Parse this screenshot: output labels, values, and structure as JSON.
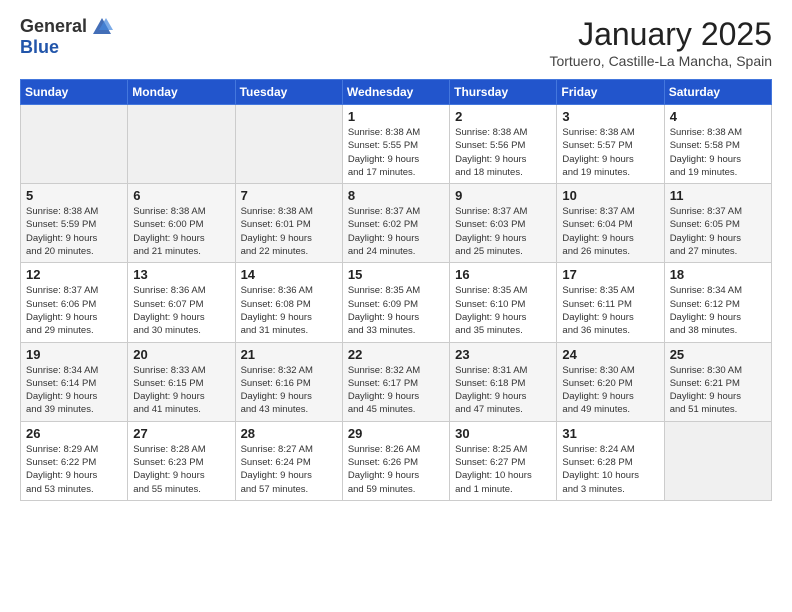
{
  "header": {
    "logo_general": "General",
    "logo_blue": "Blue",
    "month_title": "January 2025",
    "location": "Tortuero, Castille-La Mancha, Spain"
  },
  "weekdays": [
    "Sunday",
    "Monday",
    "Tuesday",
    "Wednesday",
    "Thursday",
    "Friday",
    "Saturday"
  ],
  "weeks": [
    [
      {
        "day": "",
        "info": ""
      },
      {
        "day": "",
        "info": ""
      },
      {
        "day": "",
        "info": ""
      },
      {
        "day": "1",
        "info": "Sunrise: 8:38 AM\nSunset: 5:55 PM\nDaylight: 9 hours\nand 17 minutes."
      },
      {
        "day": "2",
        "info": "Sunrise: 8:38 AM\nSunset: 5:56 PM\nDaylight: 9 hours\nand 18 minutes."
      },
      {
        "day": "3",
        "info": "Sunrise: 8:38 AM\nSunset: 5:57 PM\nDaylight: 9 hours\nand 19 minutes."
      },
      {
        "day": "4",
        "info": "Sunrise: 8:38 AM\nSunset: 5:58 PM\nDaylight: 9 hours\nand 19 minutes."
      }
    ],
    [
      {
        "day": "5",
        "info": "Sunrise: 8:38 AM\nSunset: 5:59 PM\nDaylight: 9 hours\nand 20 minutes."
      },
      {
        "day": "6",
        "info": "Sunrise: 8:38 AM\nSunset: 6:00 PM\nDaylight: 9 hours\nand 21 minutes."
      },
      {
        "day": "7",
        "info": "Sunrise: 8:38 AM\nSunset: 6:01 PM\nDaylight: 9 hours\nand 22 minutes."
      },
      {
        "day": "8",
        "info": "Sunrise: 8:37 AM\nSunset: 6:02 PM\nDaylight: 9 hours\nand 24 minutes."
      },
      {
        "day": "9",
        "info": "Sunrise: 8:37 AM\nSunset: 6:03 PM\nDaylight: 9 hours\nand 25 minutes."
      },
      {
        "day": "10",
        "info": "Sunrise: 8:37 AM\nSunset: 6:04 PM\nDaylight: 9 hours\nand 26 minutes."
      },
      {
        "day": "11",
        "info": "Sunrise: 8:37 AM\nSunset: 6:05 PM\nDaylight: 9 hours\nand 27 minutes."
      }
    ],
    [
      {
        "day": "12",
        "info": "Sunrise: 8:37 AM\nSunset: 6:06 PM\nDaylight: 9 hours\nand 29 minutes."
      },
      {
        "day": "13",
        "info": "Sunrise: 8:36 AM\nSunset: 6:07 PM\nDaylight: 9 hours\nand 30 minutes."
      },
      {
        "day": "14",
        "info": "Sunrise: 8:36 AM\nSunset: 6:08 PM\nDaylight: 9 hours\nand 31 minutes."
      },
      {
        "day": "15",
        "info": "Sunrise: 8:35 AM\nSunset: 6:09 PM\nDaylight: 9 hours\nand 33 minutes."
      },
      {
        "day": "16",
        "info": "Sunrise: 8:35 AM\nSunset: 6:10 PM\nDaylight: 9 hours\nand 35 minutes."
      },
      {
        "day": "17",
        "info": "Sunrise: 8:35 AM\nSunset: 6:11 PM\nDaylight: 9 hours\nand 36 minutes."
      },
      {
        "day": "18",
        "info": "Sunrise: 8:34 AM\nSunset: 6:12 PM\nDaylight: 9 hours\nand 38 minutes."
      }
    ],
    [
      {
        "day": "19",
        "info": "Sunrise: 8:34 AM\nSunset: 6:14 PM\nDaylight: 9 hours\nand 39 minutes."
      },
      {
        "day": "20",
        "info": "Sunrise: 8:33 AM\nSunset: 6:15 PM\nDaylight: 9 hours\nand 41 minutes."
      },
      {
        "day": "21",
        "info": "Sunrise: 8:32 AM\nSunset: 6:16 PM\nDaylight: 9 hours\nand 43 minutes."
      },
      {
        "day": "22",
        "info": "Sunrise: 8:32 AM\nSunset: 6:17 PM\nDaylight: 9 hours\nand 45 minutes."
      },
      {
        "day": "23",
        "info": "Sunrise: 8:31 AM\nSunset: 6:18 PM\nDaylight: 9 hours\nand 47 minutes."
      },
      {
        "day": "24",
        "info": "Sunrise: 8:30 AM\nSunset: 6:20 PM\nDaylight: 9 hours\nand 49 minutes."
      },
      {
        "day": "25",
        "info": "Sunrise: 8:30 AM\nSunset: 6:21 PM\nDaylight: 9 hours\nand 51 minutes."
      }
    ],
    [
      {
        "day": "26",
        "info": "Sunrise: 8:29 AM\nSunset: 6:22 PM\nDaylight: 9 hours\nand 53 minutes."
      },
      {
        "day": "27",
        "info": "Sunrise: 8:28 AM\nSunset: 6:23 PM\nDaylight: 9 hours\nand 55 minutes."
      },
      {
        "day": "28",
        "info": "Sunrise: 8:27 AM\nSunset: 6:24 PM\nDaylight: 9 hours\nand 57 minutes."
      },
      {
        "day": "29",
        "info": "Sunrise: 8:26 AM\nSunset: 6:26 PM\nDaylight: 9 hours\nand 59 minutes."
      },
      {
        "day": "30",
        "info": "Sunrise: 8:25 AM\nSunset: 6:27 PM\nDaylight: 10 hours\nand 1 minute."
      },
      {
        "day": "31",
        "info": "Sunrise: 8:24 AM\nSunset: 6:28 PM\nDaylight: 10 hours\nand 3 minutes."
      },
      {
        "day": "",
        "info": ""
      }
    ]
  ]
}
